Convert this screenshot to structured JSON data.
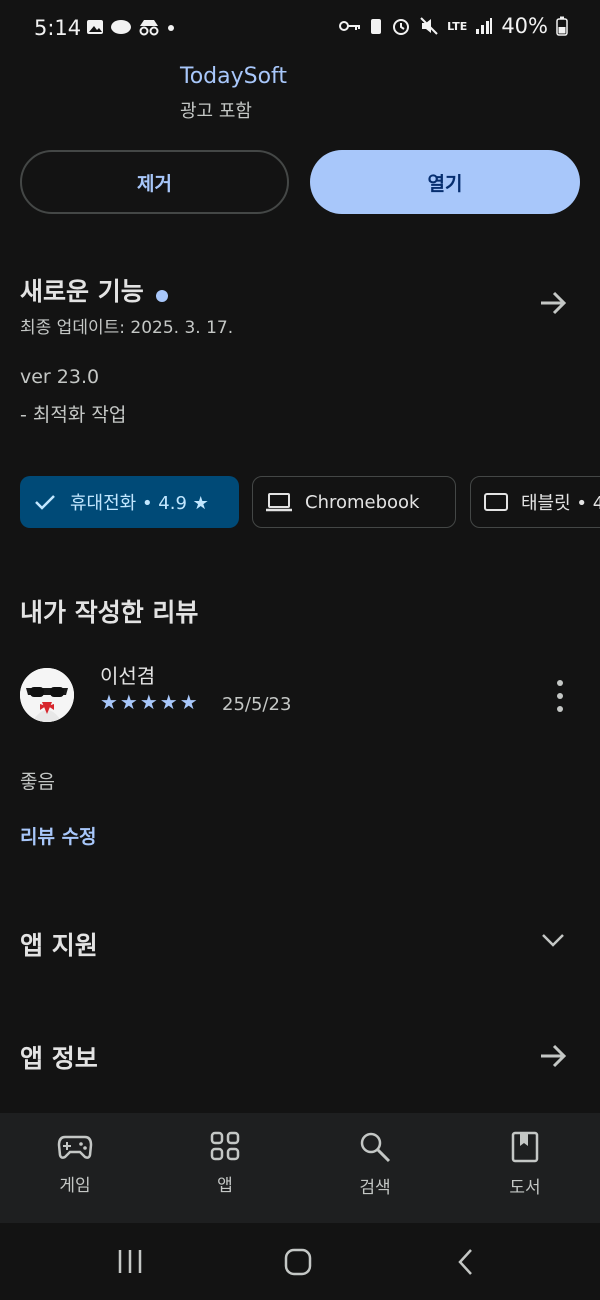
{
  "status_bar": {
    "time": "5:14",
    "network": "LTE",
    "battery": "40%"
  },
  "app_header": {
    "developer": "TodaySoft",
    "ads_label": "광고 포함"
  },
  "actions": {
    "remove_label": "제거",
    "open_label": "열기"
  },
  "whats_new": {
    "title": "새로운 기능",
    "last_updated": "최종 업데이트: 2025. 3. 17.",
    "version": "ver 23.0",
    "notes": "- 최적화 작업"
  },
  "device_chips": [
    {
      "label": "휴대전화 • 4.9 ★",
      "selected": true
    },
    {
      "label": "Chromebook",
      "selected": false
    },
    {
      "label": "태블릿 • 4",
      "selected": false
    }
  ],
  "my_review": {
    "title": "내가 작성한 리뷰",
    "reviewer": "이선겸",
    "rating": 5,
    "stars_text": "★★★★★",
    "date": "25/5/23",
    "text": "좋음",
    "edit_label": "리뷰 수정"
  },
  "app_support": {
    "title": "앱 지원"
  },
  "app_info": {
    "title": "앱 정보"
  },
  "bottom_nav": {
    "items": [
      {
        "label": "게임",
        "icon": "gamepad-icon"
      },
      {
        "label": "앱",
        "icon": "apps-grid-icon"
      },
      {
        "label": "검색",
        "icon": "search-icon"
      },
      {
        "label": "도서",
        "icon": "book-icon"
      }
    ]
  },
  "colors": {
    "background": "#131313",
    "accent": "#a8c7fa",
    "selected_chip": "#004a77"
  }
}
